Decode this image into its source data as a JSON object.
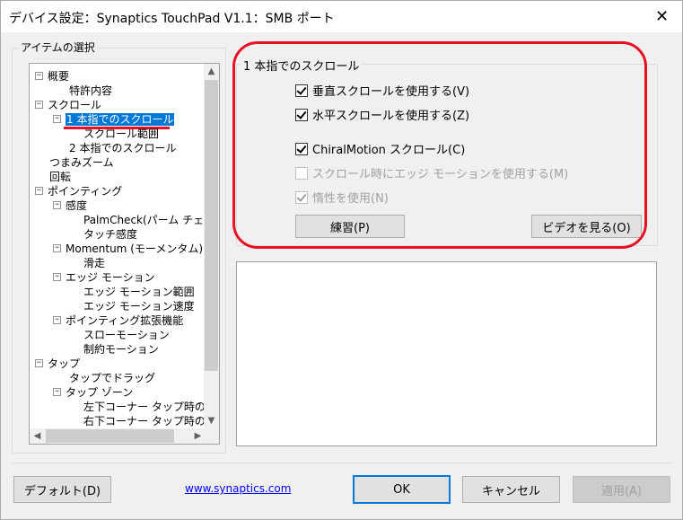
{
  "window": {
    "title": "デバイス設定：Synaptics TouchPad V1.1：SMB ポート",
    "close_glyph": "✕"
  },
  "left_panel": {
    "legend": "アイテムの選択",
    "tree": [
      {
        "label": "概要",
        "toggle": "−"
      },
      {
        "label": "特許内容"
      },
      {
        "label": "スクロール",
        "toggle": "−"
      },
      {
        "label": "1 本指でのスクロール",
        "toggle": "−",
        "selected": true
      },
      {
        "label": "スクロール範囲"
      },
      {
        "label": "2 本指でのスクロール"
      },
      {
        "label": "つまみズーム"
      },
      {
        "label": "回転"
      },
      {
        "label": "ポインティング",
        "toggle": "−"
      },
      {
        "label": "感度",
        "toggle": "−"
      },
      {
        "label": "PalmCheck(パーム チェック)"
      },
      {
        "label": "タッチ感度"
      },
      {
        "label": "Momentum (モーメンタム)",
        "toggle": "−"
      },
      {
        "label": "滑走"
      },
      {
        "label": "エッジ モーション",
        "toggle": "−"
      },
      {
        "label": "エッジ モーション範囲"
      },
      {
        "label": "エッジ モーション速度"
      },
      {
        "label": "ポインティング拡張機能",
        "toggle": "−"
      },
      {
        "label": "スローモーション"
      },
      {
        "label": "制約モーション"
      },
      {
        "label": "タップ",
        "toggle": "−"
      },
      {
        "label": "タップでドラッグ"
      },
      {
        "label": "タップ ゾーン",
        "toggle": "−"
      },
      {
        "label": "左下コーナー タップ時の動作"
      },
      {
        "label": "右下コーナー タップ時の動作"
      }
    ],
    "scroll": {
      "up": "▲",
      "down": "▼",
      "left": "◀",
      "right": "▶"
    }
  },
  "settings": {
    "legend": "1 本指でのスクロール",
    "checkboxes": [
      {
        "label": "垂直スクロールを使用する(V)",
        "checked": true,
        "enabled": true
      },
      {
        "label": "水平スクロールを使用する(Z)",
        "checked": true,
        "enabled": true
      },
      {
        "label": "ChiralMotion スクロール(C)",
        "checked": true,
        "enabled": true
      },
      {
        "label": "スクロール時にエッジ モーションを使用する(M)",
        "checked": false,
        "enabled": false
      },
      {
        "label": "惰性を使用(N)",
        "checked": true,
        "enabled": false
      }
    ],
    "practice_button": "練習(P)",
    "video_button": "ビデオを見る(O)"
  },
  "footer": {
    "default_button": "デフォルト(D)",
    "link": "www.synaptics.com",
    "ok_button": "OK",
    "cancel_button": "キャンセル",
    "apply_button": "適用(A)"
  },
  "colors": {
    "selection": "#0078d7",
    "highlight": "#e81123",
    "link": "#0000ff"
  }
}
